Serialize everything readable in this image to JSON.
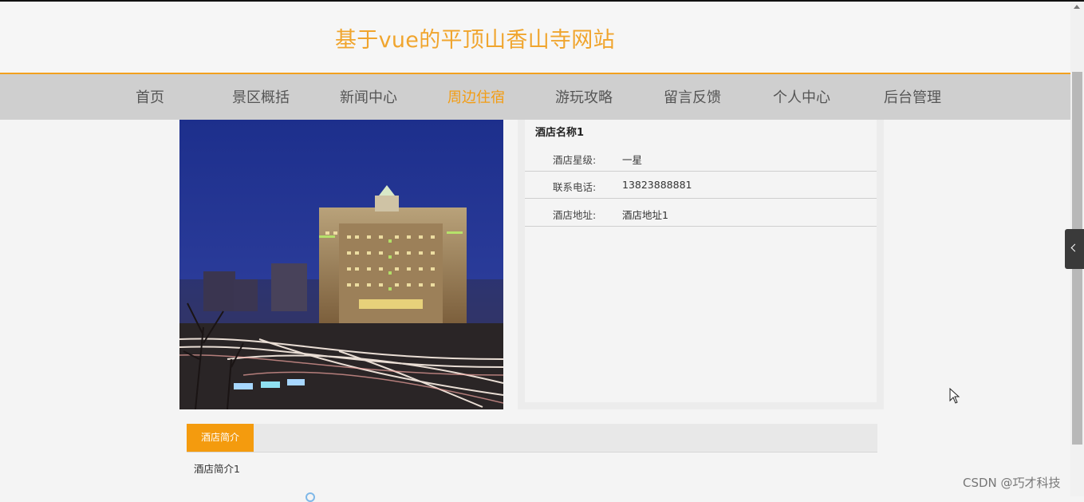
{
  "site": {
    "title": "基于vue的平顶山香山寺网站"
  },
  "nav": {
    "items": [
      {
        "label": "首页"
      },
      {
        "label": "景区概括"
      },
      {
        "label": "新闻中心"
      },
      {
        "label": "周边住宿"
      },
      {
        "label": "游玩攻略"
      },
      {
        "label": "留言反馈"
      },
      {
        "label": "个人中心"
      },
      {
        "label": "后台管理"
      }
    ],
    "active": "周边住宿",
    "accent_color": "#f39c12"
  },
  "hotel": {
    "name": "酒店名称1",
    "fields": [
      {
        "label": "酒店星级:",
        "value": "一星"
      },
      {
        "label": "联系电话:",
        "value": "13823888881"
      },
      {
        "label": "酒店地址:",
        "value": "酒店地址1"
      }
    ],
    "tab_label": "酒店简介",
    "description": "酒店简介1"
  },
  "watermark": "CSDN @巧才科技",
  "colors": {
    "title": "#f0a52e",
    "nav_bg": "#cfcfcf",
    "tab_active": "#f49b0e"
  },
  "icons": {
    "side_toggle": "chevron-left-icon",
    "cursor": "mouse-pointer-icon"
  }
}
